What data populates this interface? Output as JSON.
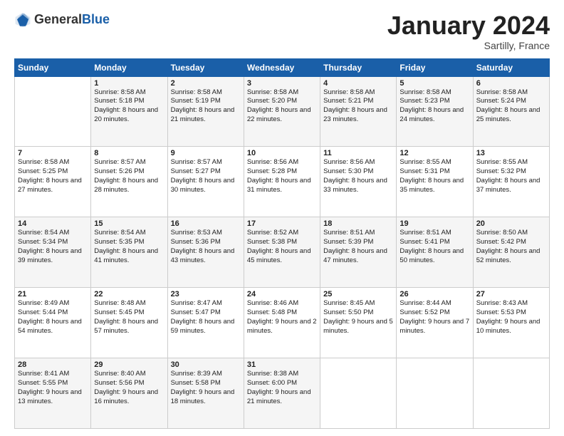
{
  "logo": {
    "general": "General",
    "blue": "Blue"
  },
  "header": {
    "month": "January 2024",
    "location": "Sartilly, France"
  },
  "days": [
    "Sunday",
    "Monday",
    "Tuesday",
    "Wednesday",
    "Thursday",
    "Friday",
    "Saturday"
  ],
  "weeks": [
    [
      {
        "day": "",
        "sunrise": "",
        "sunset": "",
        "daylight": ""
      },
      {
        "day": "1",
        "sunrise": "Sunrise: 8:58 AM",
        "sunset": "Sunset: 5:18 PM",
        "daylight": "Daylight: 8 hours and 20 minutes."
      },
      {
        "day": "2",
        "sunrise": "Sunrise: 8:58 AM",
        "sunset": "Sunset: 5:19 PM",
        "daylight": "Daylight: 8 hours and 21 minutes."
      },
      {
        "day": "3",
        "sunrise": "Sunrise: 8:58 AM",
        "sunset": "Sunset: 5:20 PM",
        "daylight": "Daylight: 8 hours and 22 minutes."
      },
      {
        "day": "4",
        "sunrise": "Sunrise: 8:58 AM",
        "sunset": "Sunset: 5:21 PM",
        "daylight": "Daylight: 8 hours and 23 minutes."
      },
      {
        "day": "5",
        "sunrise": "Sunrise: 8:58 AM",
        "sunset": "Sunset: 5:23 PM",
        "daylight": "Daylight: 8 hours and 24 minutes."
      },
      {
        "day": "6",
        "sunrise": "Sunrise: 8:58 AM",
        "sunset": "Sunset: 5:24 PM",
        "daylight": "Daylight: 8 hours and 25 minutes."
      }
    ],
    [
      {
        "day": "7",
        "sunrise": "Sunrise: 8:58 AM",
        "sunset": "Sunset: 5:25 PM",
        "daylight": "Daylight: 8 hours and 27 minutes."
      },
      {
        "day": "8",
        "sunrise": "Sunrise: 8:57 AM",
        "sunset": "Sunset: 5:26 PM",
        "daylight": "Daylight: 8 hours and 28 minutes."
      },
      {
        "day": "9",
        "sunrise": "Sunrise: 8:57 AM",
        "sunset": "Sunset: 5:27 PM",
        "daylight": "Daylight: 8 hours and 30 minutes."
      },
      {
        "day": "10",
        "sunrise": "Sunrise: 8:56 AM",
        "sunset": "Sunset: 5:28 PM",
        "daylight": "Daylight: 8 hours and 31 minutes."
      },
      {
        "day": "11",
        "sunrise": "Sunrise: 8:56 AM",
        "sunset": "Sunset: 5:30 PM",
        "daylight": "Daylight: 8 hours and 33 minutes."
      },
      {
        "day": "12",
        "sunrise": "Sunrise: 8:55 AM",
        "sunset": "Sunset: 5:31 PM",
        "daylight": "Daylight: 8 hours and 35 minutes."
      },
      {
        "day": "13",
        "sunrise": "Sunrise: 8:55 AM",
        "sunset": "Sunset: 5:32 PM",
        "daylight": "Daylight: 8 hours and 37 minutes."
      }
    ],
    [
      {
        "day": "14",
        "sunrise": "Sunrise: 8:54 AM",
        "sunset": "Sunset: 5:34 PM",
        "daylight": "Daylight: 8 hours and 39 minutes."
      },
      {
        "day": "15",
        "sunrise": "Sunrise: 8:54 AM",
        "sunset": "Sunset: 5:35 PM",
        "daylight": "Daylight: 8 hours and 41 minutes."
      },
      {
        "day": "16",
        "sunrise": "Sunrise: 8:53 AM",
        "sunset": "Sunset: 5:36 PM",
        "daylight": "Daylight: 8 hours and 43 minutes."
      },
      {
        "day": "17",
        "sunrise": "Sunrise: 8:52 AM",
        "sunset": "Sunset: 5:38 PM",
        "daylight": "Daylight: 8 hours and 45 minutes."
      },
      {
        "day": "18",
        "sunrise": "Sunrise: 8:51 AM",
        "sunset": "Sunset: 5:39 PM",
        "daylight": "Daylight: 8 hours and 47 minutes."
      },
      {
        "day": "19",
        "sunrise": "Sunrise: 8:51 AM",
        "sunset": "Sunset: 5:41 PM",
        "daylight": "Daylight: 8 hours and 50 minutes."
      },
      {
        "day": "20",
        "sunrise": "Sunrise: 8:50 AM",
        "sunset": "Sunset: 5:42 PM",
        "daylight": "Daylight: 8 hours and 52 minutes."
      }
    ],
    [
      {
        "day": "21",
        "sunrise": "Sunrise: 8:49 AM",
        "sunset": "Sunset: 5:44 PM",
        "daylight": "Daylight: 8 hours and 54 minutes."
      },
      {
        "day": "22",
        "sunrise": "Sunrise: 8:48 AM",
        "sunset": "Sunset: 5:45 PM",
        "daylight": "Daylight: 8 hours and 57 minutes."
      },
      {
        "day": "23",
        "sunrise": "Sunrise: 8:47 AM",
        "sunset": "Sunset: 5:47 PM",
        "daylight": "Daylight: 8 hours and 59 minutes."
      },
      {
        "day": "24",
        "sunrise": "Sunrise: 8:46 AM",
        "sunset": "Sunset: 5:48 PM",
        "daylight": "Daylight: 9 hours and 2 minutes."
      },
      {
        "day": "25",
        "sunrise": "Sunrise: 8:45 AM",
        "sunset": "Sunset: 5:50 PM",
        "daylight": "Daylight: 9 hours and 5 minutes."
      },
      {
        "day": "26",
        "sunrise": "Sunrise: 8:44 AM",
        "sunset": "Sunset: 5:52 PM",
        "daylight": "Daylight: 9 hours and 7 minutes."
      },
      {
        "day": "27",
        "sunrise": "Sunrise: 8:43 AM",
        "sunset": "Sunset: 5:53 PM",
        "daylight": "Daylight: 9 hours and 10 minutes."
      }
    ],
    [
      {
        "day": "28",
        "sunrise": "Sunrise: 8:41 AM",
        "sunset": "Sunset: 5:55 PM",
        "daylight": "Daylight: 9 hours and 13 minutes."
      },
      {
        "day": "29",
        "sunrise": "Sunrise: 8:40 AM",
        "sunset": "Sunset: 5:56 PM",
        "daylight": "Daylight: 9 hours and 16 minutes."
      },
      {
        "day": "30",
        "sunrise": "Sunrise: 8:39 AM",
        "sunset": "Sunset: 5:58 PM",
        "daylight": "Daylight: 9 hours and 18 minutes."
      },
      {
        "day": "31",
        "sunrise": "Sunrise: 8:38 AM",
        "sunset": "Sunset: 6:00 PM",
        "daylight": "Daylight: 9 hours and 21 minutes."
      },
      {
        "day": "",
        "sunrise": "",
        "sunset": "",
        "daylight": ""
      },
      {
        "day": "",
        "sunrise": "",
        "sunset": "",
        "daylight": ""
      },
      {
        "day": "",
        "sunrise": "",
        "sunset": "",
        "daylight": ""
      }
    ]
  ]
}
